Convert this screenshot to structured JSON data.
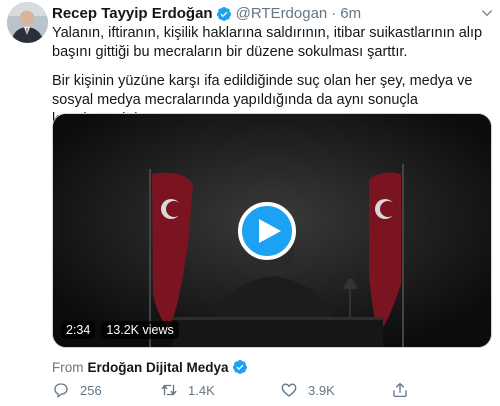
{
  "tweet": {
    "author_name": "Recep Tayyip Erdoğan",
    "handle": "@RTErdogan",
    "separator": "·",
    "time": "6m",
    "paragraph1": "Yalanın, iftiranın, kişilik haklarına saldırının, itibar suikastlarının alıp başını gittiği bu mecraların bir düzene sokulması şarttır.",
    "paragraph2": "Bir kişinin yüzüne karşı ifa edildiğinde suç olan her şey, medya ve sosyal medya mecralarında yapıldığında da aynı sonuçla karşılaşmalıdır."
  },
  "video": {
    "duration": "2:34",
    "views": "13.2K views"
  },
  "source": {
    "from_label": "From",
    "name": "Erdoğan Dijital Medya"
  },
  "actions": {
    "replies": "256",
    "retweets": "1.4K",
    "likes": "3.9K"
  },
  "colors": {
    "accent": "#1da1f2",
    "text": "#14171a",
    "secondary": "#657786",
    "flag_red": "#c8102e"
  }
}
